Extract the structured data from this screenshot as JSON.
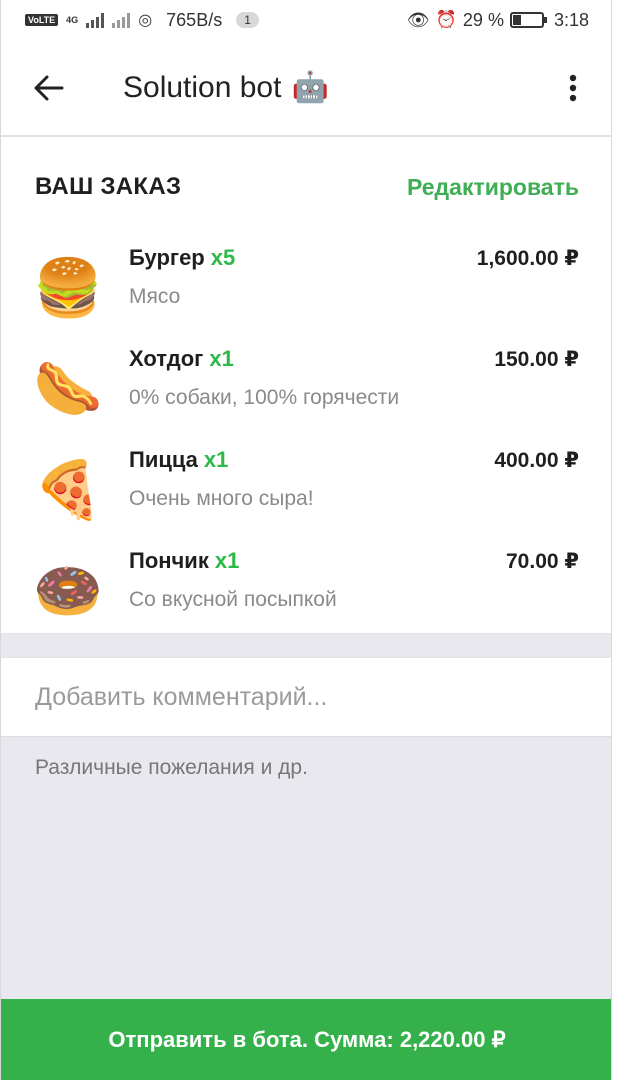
{
  "status_bar": {
    "network_speed": "765B/s",
    "notification_count": "1",
    "battery": "29 %",
    "battery_level": 0.29,
    "time": "3:18",
    "lte_label": "VoLTE",
    "net_type": "4G"
  },
  "app_bar": {
    "title": "Solution bot",
    "title_emoji": "🤖"
  },
  "order": {
    "title": "ВАШ ЗАКАЗ",
    "edit_label": "Редактировать",
    "items": [
      {
        "emoji": "🍔",
        "name": "Бургер",
        "qty": "x5",
        "desc": "Мясо",
        "price": "1,600.00 ₽"
      },
      {
        "emoji": "🌭",
        "name": "Хотдог",
        "qty": "x1",
        "desc": "0% собаки, 100% горячести",
        "price": "150.00 ₽"
      },
      {
        "emoji": "🍕",
        "name": "Пицца",
        "qty": "x1",
        "desc": "Очень много сыра!",
        "price": "400.00 ₽"
      },
      {
        "emoji": "🍩",
        "name": "Пончик",
        "qty": "x1",
        "desc": "Со вкусной посыпкой",
        "price": "70.00 ₽"
      }
    ]
  },
  "comment": {
    "placeholder": "Добавить комментарий...",
    "value": "",
    "hint": "Различные пожелания и др."
  },
  "submit": {
    "label": "Отправить в бота. Сумма: 2,220.00 ₽"
  },
  "colors": {
    "accent_green": "#35b14c",
    "qty_green": "#2eb84a"
  }
}
